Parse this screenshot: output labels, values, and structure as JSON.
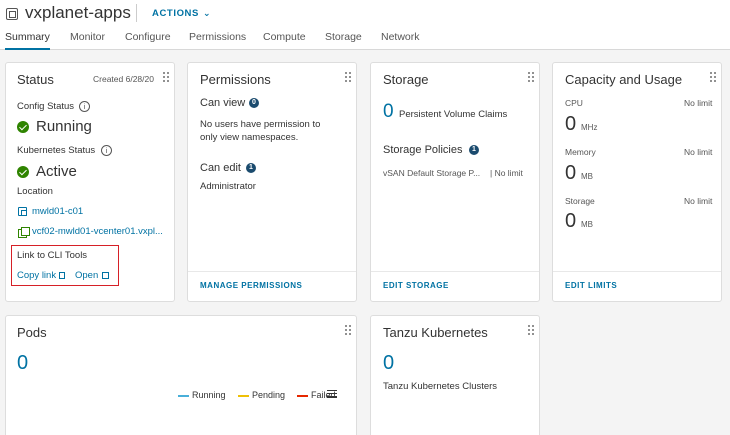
{
  "header": {
    "title": "vxplanet-apps",
    "actions_label": "ACTIONS"
  },
  "tabs": [
    {
      "label": "Summary",
      "active": true
    },
    {
      "label": "Monitor"
    },
    {
      "label": "Configure"
    },
    {
      "label": "Permissions"
    },
    {
      "label": "Compute"
    },
    {
      "label": "Storage"
    },
    {
      "label": "Network"
    }
  ],
  "status": {
    "title": "Status",
    "created": "Created 6/28/20",
    "config_status_label": "Config Status",
    "config_status_value": "Running",
    "k8s_status_label": "Kubernetes Status",
    "k8s_status_value": "Active",
    "location_label": "Location",
    "cluster": "mwld01-c01",
    "vcenter": "vcf02-mwld01-vcenter01.vxpl...",
    "cli_label": "Link to CLI Tools",
    "copy_link": "Copy link",
    "open": "Open"
  },
  "permissions": {
    "title": "Permissions",
    "can_view_label": "Can view",
    "can_view_count": "0",
    "no_users_text": "No users have permission to only view namespaces.",
    "can_edit_label": "Can edit",
    "can_edit_count": "1",
    "editor": "Administrator",
    "footer": "MANAGE PERMISSIONS"
  },
  "storage": {
    "title": "Storage",
    "pvc_count": "0",
    "pvc_label": "Persistent Volume Claims",
    "policies_label": "Storage Policies",
    "policies_count": "1",
    "policy_name": "vSAN Default Storage P...",
    "policy_limit": "| No limit",
    "footer": "EDIT STORAGE"
  },
  "capacity": {
    "title": "Capacity and Usage",
    "cpu_label": "CPU",
    "cpu_limit": "No limit",
    "cpu_value": "0",
    "cpu_unit": "MHz",
    "memory_label": "Memory",
    "memory_limit": "No limit",
    "memory_value": "0",
    "memory_unit": "MB",
    "storage_label": "Storage",
    "storage_limit": "No limit",
    "storage_value": "0",
    "storage_unit": "MB",
    "footer": "EDIT LIMITS"
  },
  "pods": {
    "title": "Pods",
    "count": "0",
    "legend": [
      {
        "label": "Running",
        "color": "#49afd9"
      },
      {
        "label": "Pending",
        "color": "#efc006"
      },
      {
        "label": "Failed",
        "color": "#e62700"
      }
    ]
  },
  "tanzu": {
    "title": "Tanzu Kubernetes",
    "count": "0",
    "label": "Tanzu Kubernetes Clusters"
  },
  "colors": {
    "accent": "#0072a3",
    "success": "#2f8400",
    "highlight": "#d62027"
  },
  "icons": {
    "namespace": "namespace-icon",
    "actions": "chevron-down-icon",
    "info": "info-icon",
    "check": "check-circle-icon",
    "cluster": "cluster-icon",
    "vcenter": "vcenter-icon",
    "copy": "copy-icon",
    "open": "external-link-icon",
    "grip": "drag-handle-icon",
    "menu": "menu-icon"
  }
}
